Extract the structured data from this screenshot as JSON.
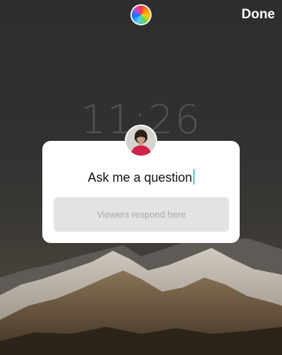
{
  "status": {
    "clock_time": "11:26"
  },
  "toolbar": {
    "done_label": "Done",
    "color_picker_icon": "color-wheel-icon"
  },
  "question_sticker": {
    "prompt": "Ask me a question",
    "response_placeholder": "Viewers respond here",
    "avatar": "profile-photo"
  },
  "colors": {
    "caret": "#5ac8b8",
    "card": "#ffffff",
    "response_box": "#e3e3e3"
  }
}
